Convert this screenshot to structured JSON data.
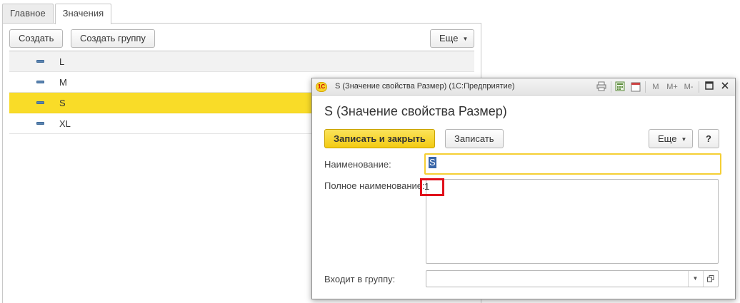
{
  "tabs": [
    {
      "label": "Главное"
    },
    {
      "label": "Значения"
    }
  ],
  "list_toolbar": {
    "create_label": "Создать",
    "create_group_label": "Создать группу",
    "more_label": "Еще"
  },
  "list": {
    "rows": [
      {
        "name": "L"
      },
      {
        "name": "M"
      },
      {
        "name": "S",
        "selected": true
      },
      {
        "name": "XL"
      }
    ]
  },
  "dialog": {
    "window_title": "S (Значение свойства Размер)  (1С:Предприятие)",
    "app_logo": "1С",
    "titlebar_icons": {
      "m": "M",
      "m_plus": "M+",
      "m_minus": "M-",
      "calendar_day": "31"
    },
    "heading": "S (Значение свойства Размер)",
    "toolbar": {
      "save_close_label": "Записать и закрыть",
      "save_label": "Записать",
      "more_label": "Еще",
      "help_label": "?"
    },
    "fields": {
      "name_label": "Наименование:",
      "name_value": "S",
      "full_name_label": "Полное наименование:",
      "full_name_value": "1",
      "group_label": "Входит в группу:",
      "group_value": ""
    }
  },
  "colors": {
    "selected_row": "#f9dc28",
    "primary_button": "#f3cb13",
    "focus_border": "#f5cf34",
    "highlight_box": "#e0101b"
  }
}
